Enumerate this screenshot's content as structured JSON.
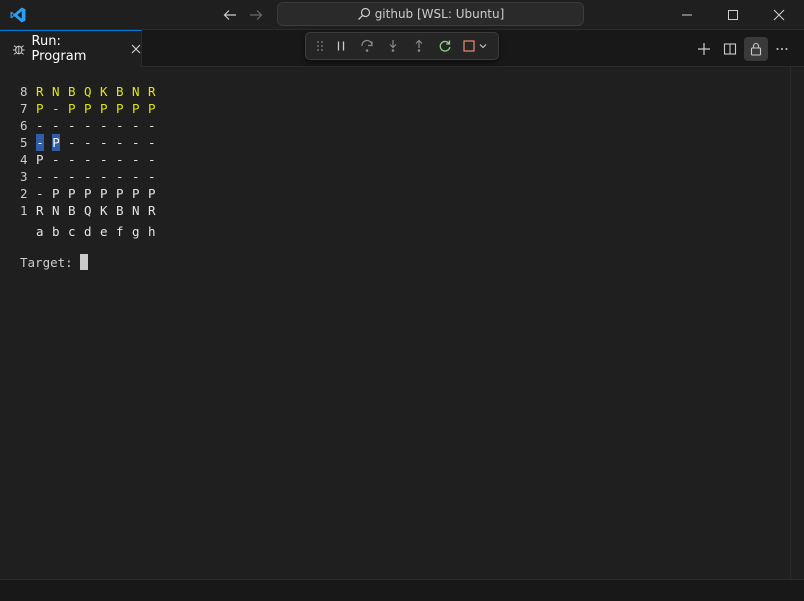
{
  "titlebar": {
    "command_center_label": "github [WSL: Ubuntu]",
    "icons": [
      "vscode-logo",
      "arrow-left-icon",
      "arrow-right-icon",
      "search-icon",
      "minimize-icon",
      "maximize-icon",
      "close-icon"
    ]
  },
  "tab": {
    "label": "Run: Program",
    "icon": "debug-bug-icon"
  },
  "debug_toolbar": {
    "buttons": [
      "drag-handle",
      "pause",
      "step-over",
      "step-into",
      "step-out",
      "restart",
      "stop",
      "chevron-down"
    ],
    "colors": {
      "restart": "#89d185",
      "stop": "#f48771"
    }
  },
  "tab_actions": [
    "add",
    "split-editor",
    "lock",
    "more"
  ],
  "terminal": {
    "colors": {
      "yellow": "#e5e510",
      "white": "#e5e5e5",
      "highlight": "#2f5da6"
    },
    "board": [
      {
        "rank": "8",
        "cells": [
          "R",
          "N",
          "B",
          "Q",
          "K",
          "B",
          "N",
          "R"
        ],
        "color": "yellow"
      },
      {
        "rank": "7",
        "cells": [
          "P",
          "-",
          "P",
          "P",
          "P",
          "P",
          "P",
          "P"
        ],
        "color": "yellow"
      },
      {
        "rank": "6",
        "cells": [
          "-",
          "-",
          "-",
          "-",
          "-",
          "-",
          "-",
          "-"
        ],
        "color": "white"
      },
      {
        "rank": "5",
        "cells": [
          "-",
          "P",
          "-",
          "-",
          "-",
          "-",
          "-",
          "-"
        ],
        "color": "white",
        "highlight": [
          0,
          1
        ]
      },
      {
        "rank": "4",
        "cells": [
          "P",
          "-",
          "-",
          "-",
          "-",
          "-",
          "-",
          "-"
        ],
        "color": "white"
      },
      {
        "rank": "3",
        "cells": [
          "-",
          "-",
          "-",
          "-",
          "-",
          "-",
          "-",
          "-"
        ],
        "color": "white"
      },
      {
        "rank": "2",
        "cells": [
          "-",
          "P",
          "P",
          "P",
          "P",
          "P",
          "P",
          "P"
        ],
        "color": "white"
      },
      {
        "rank": "1",
        "cells": [
          "R",
          "N",
          "B",
          "Q",
          "K",
          "B",
          "N",
          "R"
        ],
        "color": "white"
      }
    ],
    "files": [
      "a",
      "b",
      "c",
      "d",
      "e",
      "f",
      "g",
      "h"
    ],
    "prompt": "Target: "
  }
}
